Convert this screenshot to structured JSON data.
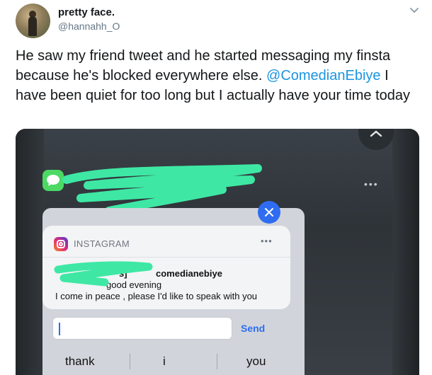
{
  "user": {
    "display_name": "pretty face.",
    "handle": "@hannahh_O"
  },
  "tweet": {
    "text_before_mention": "He saw my friend tweet and he started messaging my finsta because he's blocked everywhere else. ",
    "mention": "@ComedianEbiye",
    "text_after_mention": " I have been quiet for too long but I actually have your time today"
  },
  "screenshot": {
    "notification": {
      "app_label": "INSTAGRAM",
      "more": "•••",
      "sender_prefix": "s]",
      "sender": "comedianebiye",
      "line1": "good evening",
      "line2": "I come in peace , please I'd like to speak with you"
    },
    "reply": {
      "send_label": "Send"
    },
    "suggestions": [
      "thank",
      "i",
      "you"
    ],
    "header_more": "•••"
  },
  "colors": {
    "mention": "#1b95e0",
    "scribble": "#3ee8a4",
    "ios_blue": "#2f6cf1"
  }
}
